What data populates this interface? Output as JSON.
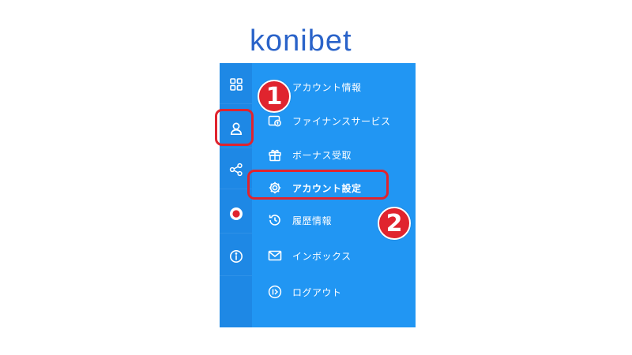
{
  "brand": {
    "logo_text": "konibet",
    "logo_color": "#2a63c9"
  },
  "colors": {
    "panel": "#2196f3",
    "rail": "#1e88e5",
    "callout": "#e0242e"
  },
  "rail_icons": [
    "grid-icon",
    "user-icon",
    "share-icon",
    "record-icon",
    "info-icon"
  ],
  "menu": {
    "items": [
      {
        "label": "アカウント情報",
        "icon": "id-card-icon"
      },
      {
        "label": "ファイナンスサービス",
        "icon": "wallet-icon"
      },
      {
        "label": "ボーナス受取",
        "icon": "gift-icon"
      },
      {
        "label": "アカウント設定",
        "icon": "gear-icon"
      },
      {
        "label": "履歴情報",
        "icon": "history-icon"
      },
      {
        "label": "インボックス",
        "icon": "mail-icon"
      },
      {
        "label": "ログアウト",
        "icon": "logout-icon"
      }
    ]
  },
  "callouts": {
    "step1": "1",
    "step2": "2"
  }
}
